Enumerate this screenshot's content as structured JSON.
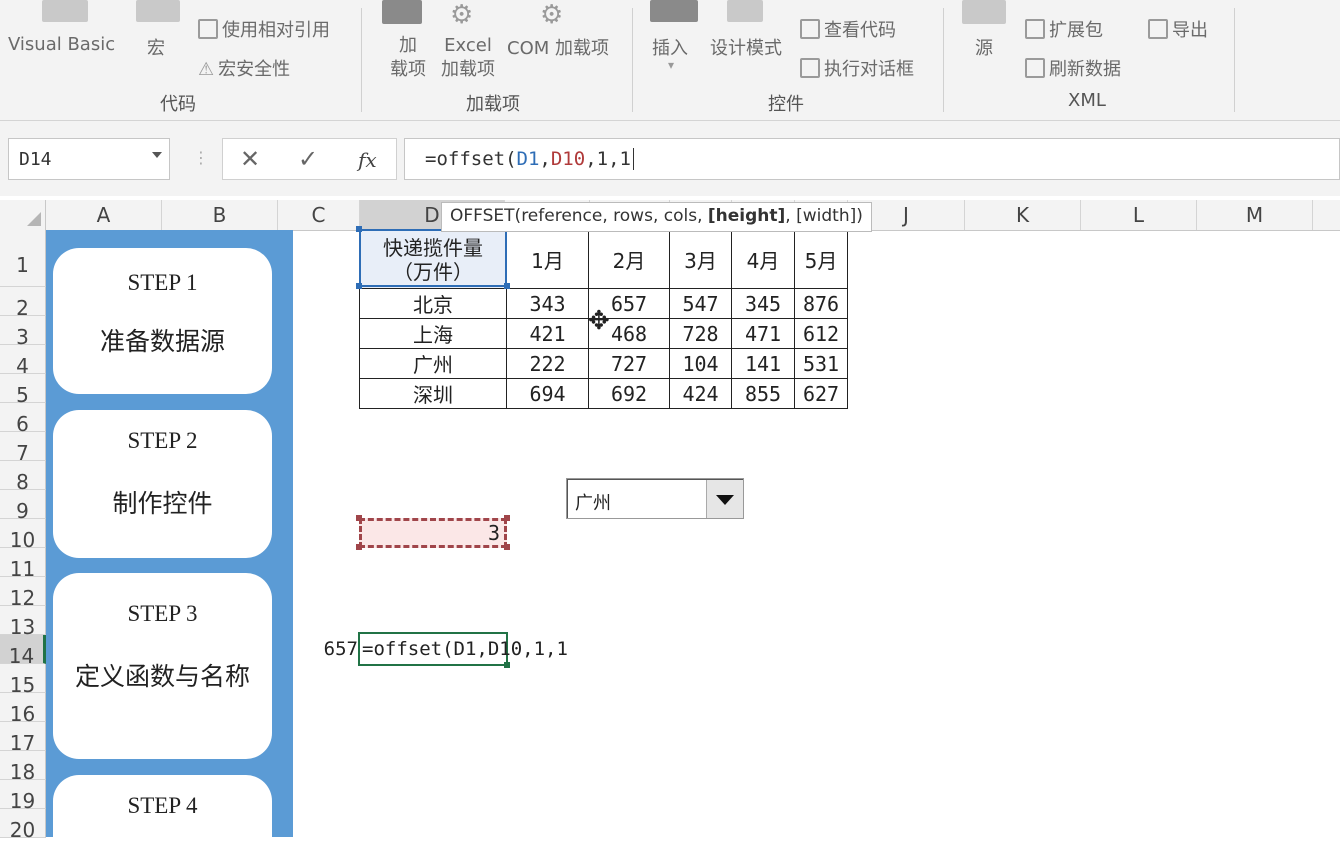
{
  "ribbon": {
    "code_group": {
      "visual_basic": "Visual Basic",
      "macros": "宏",
      "relative_refs": "使用相对引用",
      "macro_security": "宏安全性",
      "label": "代码"
    },
    "addins_group": {
      "addins": "加\n载项",
      "excel_addins": "Excel\n加载项",
      "com_addins": "COM 加载项",
      "label": "加载项"
    },
    "controls_group": {
      "insert": "插入",
      "design_mode": "设计模式",
      "view_code": "查看代码",
      "run_dialog": "执行对话框",
      "label": "控件"
    },
    "xml_group": {
      "source": "源",
      "expansion_packs": "扩展包",
      "refresh_data": "刷新数据",
      "export": "导出",
      "label": "XML"
    }
  },
  "formula_bar": {
    "name_box": "D14",
    "cancel": "✕",
    "enter": "✓",
    "fx": "fx",
    "formula_prefix": "=offset(",
    "ref1": "D1",
    "comma1": ",",
    "ref2": "D10",
    "formula_suffix": ",1,1"
  },
  "tooltip": {
    "text": "OFFSET(reference, rows, cols, ",
    "bold": "[height]",
    "tail": ", [width])"
  },
  "columns": [
    "A",
    "B",
    "C",
    "D",
    "",
    "",
    "",
    "",
    "",
    "J",
    "K",
    "L",
    "M"
  ],
  "rows": [
    "1",
    "2",
    "3",
    "4",
    "5",
    "6",
    "7",
    "8",
    "9",
    "10",
    "11",
    "12",
    "13",
    "14",
    "15",
    "16",
    "17",
    "18",
    "19",
    "20"
  ],
  "steps": [
    {
      "title": "STEP 1",
      "desc": "准备数据源"
    },
    {
      "title": "STEP 2",
      "desc": "制作控件"
    },
    {
      "title": "STEP 3",
      "desc": "定义函数与名称"
    },
    {
      "title": "STEP 4",
      "desc": ""
    }
  ],
  "table": {
    "header": [
      "快递揽件量\n（万件）",
      "1月",
      "2月",
      "3月",
      "4月",
      "5月"
    ],
    "rows": [
      [
        "北京",
        "343",
        "657",
        "547",
        "345",
        "876"
      ],
      [
        "上海",
        "421",
        "468",
        "728",
        "471",
        "612"
      ],
      [
        "广州",
        "222",
        "727",
        "104",
        "141",
        "531"
      ],
      [
        "深圳",
        "694",
        "692",
        "424",
        "855",
        "627"
      ]
    ]
  },
  "dropdown": {
    "value": "广州"
  },
  "cell_d10": "3",
  "cell_c14": "657",
  "cell_d14": "=offset(D1,D10,1,1"
}
